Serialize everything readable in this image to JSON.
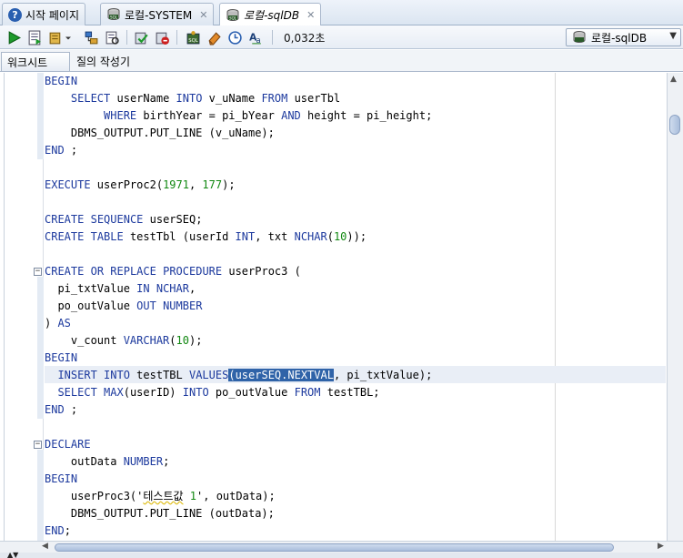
{
  "tabs": [
    {
      "label": "시작 페이지",
      "icon": "help-icon"
    },
    {
      "label": "로컬-SYSTEM",
      "icon": "sql-db-icon"
    },
    {
      "label": "로컬-sqlDB",
      "icon": "sql-db-icon"
    }
  ],
  "toolbar": {
    "elapsed_time": "0,032초",
    "connection": "로컬-sqlDB"
  },
  "subtabs": [
    "워크시트",
    "질의 작성기"
  ],
  "code": {
    "l1": "BEGIN",
    "l2a": "    ",
    "l2_select": "SELECT",
    "l2b": " userName ",
    "l2_into": "INTO",
    "l2c": " v_uName ",
    "l2_from": "FROM",
    "l2d": " userTbl",
    "l3a": "         ",
    "l3_where": "WHERE",
    "l3b": " birthYear = pi_bYear ",
    "l3_and": "AND",
    "l3c": " height = pi_height;",
    "l4": "    DBMS_OUTPUT.PUT_LINE (v_uName);",
    "l5_end": "END",
    "l5b": " ;",
    "l7_exec": "EXECUTE",
    "l7b": " userProc2(",
    "l7_n1": "1971",
    "l7c": ", ",
    "l7_n2": "177",
    "l7d": ");",
    "l9_create": "CREATE",
    "l9_seq": "SEQUENCE",
    "l9b": " userSEQ;",
    "l10_create": "CREATE",
    "l10_table": "TABLE",
    "l10b": " testTbl (userId ",
    "l10_int": "INT",
    "l10c": ", txt ",
    "l10_nchar": "NCHAR",
    "l10d": "(",
    "l10_n": "10",
    "l10e": "));",
    "l12_create": "CREATE",
    "l12_or": "OR",
    "l12_replace": "REPLACE",
    "l12_proc": "PROCEDURE",
    "l12b": " userProc3 (",
    "l13a": "  pi_txtValue ",
    "l13_in": "IN",
    "l13_nchar": "NCHAR",
    "l13b": ",",
    "l14a": "  po_outValue ",
    "l14_out": "OUT",
    "l14_number": "NUMBER",
    "l15a": ") ",
    "l15_as": "AS",
    "l16a": "    v_count ",
    "l16_varchar": "VARCHAR",
    "l16b": "(",
    "l16_n": "10",
    "l16c": ");",
    "l17": "BEGIN",
    "l18a": "  ",
    "l18_insert": "INSERT",
    "l18_into": "INTO",
    "l18b": " testTBL ",
    "l18_values": "VALUES",
    "l18c": "(",
    "l18_sel": "userSEQ.NEXTVAL",
    "l18d": ", pi_txtValue);",
    "l19a": "  ",
    "l19_select": "SELECT",
    "l19_max": "MAX",
    "l19b": "(userID) ",
    "l19_into": "INTO",
    "l19c": " po_outValue ",
    "l19_from": "FROM",
    "l19d": " testTBL;",
    "l20_end": "END",
    "l20b": " ;",
    "l22": "DECLARE",
    "l23a": "    outData ",
    "l23_number": "NUMBER",
    "l23b": ";",
    "l24": "BEGIN",
    "l25a": "    userProc3('",
    "l25_str": "테스트값",
    "l25b": " ",
    "l25_n": "1",
    "l25c": "', outData);",
    "l26": "    DBMS_OUTPUT.PUT_LINE (outData);",
    "l27_end": "END",
    "l27b": ";"
  }
}
